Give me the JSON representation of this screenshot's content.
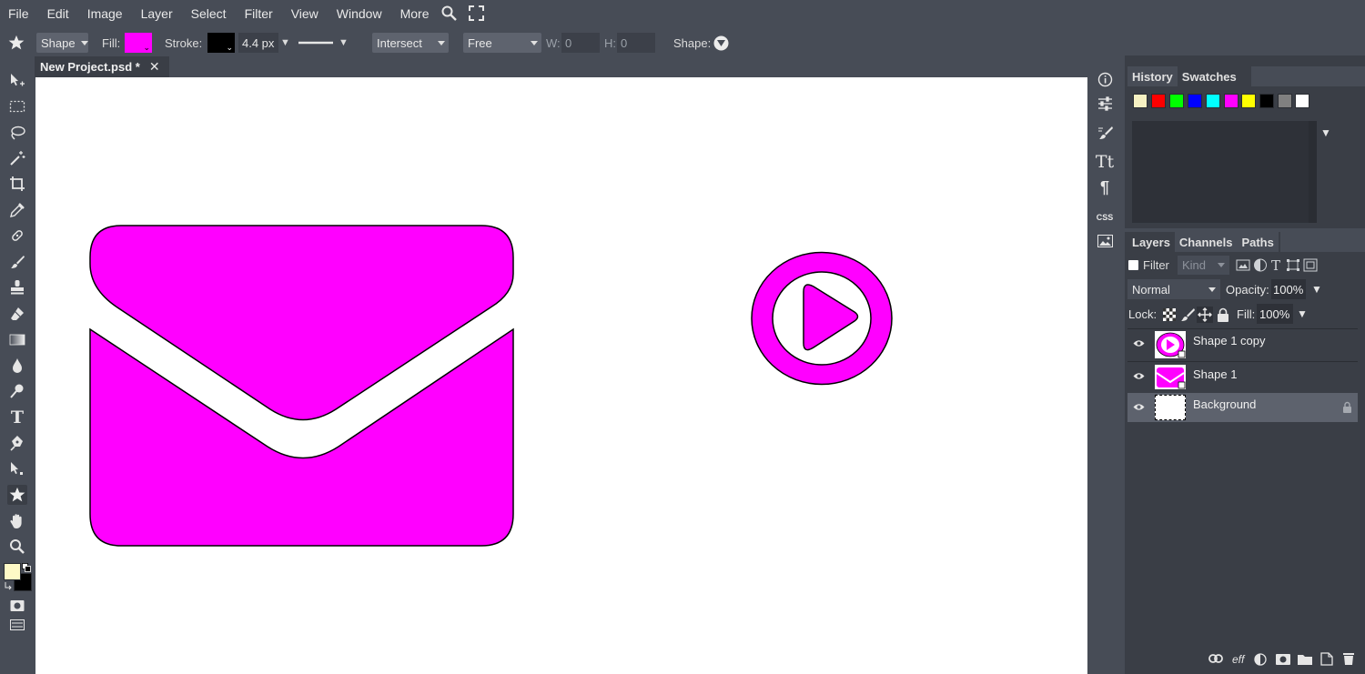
{
  "menu": {
    "items": [
      "File",
      "Edit",
      "Image",
      "Layer",
      "Select",
      "Filter",
      "View",
      "Window",
      "More"
    ]
  },
  "options": {
    "tool_mode": "Shape",
    "fill_label": "Fill:",
    "fill_color": "#ff00ff",
    "stroke_label": "Stroke:",
    "stroke_color": "#000000",
    "stroke_width": "4.4 px",
    "path_op": "Intersect",
    "constraint": "Free",
    "w_label": "W:",
    "w_value": "0",
    "h_label": "H:",
    "h_value": "0",
    "shape_label": "Shape:"
  },
  "panel_toggles": {
    "left": ">  <",
    "strip": "<>",
    "right": ">  <"
  },
  "document": {
    "tab_title": "New Project.psd *",
    "close": "✕"
  },
  "canvas": {
    "background": "#ffffff",
    "shape_fill": "#ff00ff",
    "shape_stroke": "#000000"
  },
  "toolbar": {
    "foreground_color": "#fef9c6",
    "background_color": "#000000"
  },
  "iconstrip": {
    "css_label": "CSS"
  },
  "history_panel": {
    "tabs": [
      "History",
      "Swatches"
    ],
    "active_tab": "Swatches",
    "swatches": [
      "#f6f1c2",
      "#ff0000",
      "#00ff00",
      "#0000ff",
      "#00ffff",
      "#ff00ff",
      "#ffff00",
      "#000000",
      "#808080",
      "#ffffff"
    ]
  },
  "layers_panel": {
    "tabs": [
      "Layers",
      "Channels",
      "Paths"
    ],
    "filter_label": "Filter",
    "kind_placeholder": "Kind",
    "blend_mode": "Normal",
    "opacity_label": "Opacity:",
    "opacity_value": "100%",
    "lock_label": "Lock:",
    "fill_label": "Fill:",
    "fill_value": "100%",
    "layers": [
      {
        "name": "Shape 1 copy",
        "selected": false,
        "locked": false
      },
      {
        "name": "Shape 1",
        "selected": false,
        "locked": false
      },
      {
        "name": "Background",
        "selected": true,
        "locked": true
      }
    ],
    "footer_eff": "eff"
  }
}
